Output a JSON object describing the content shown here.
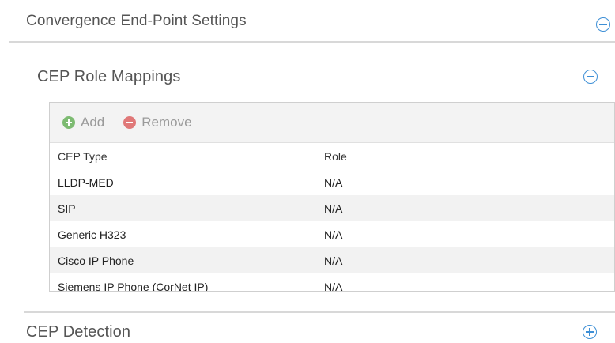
{
  "sections": {
    "convergence": {
      "title": "Convergence End-Point Settings",
      "toggle_icon": "collapse-minus-icon"
    },
    "role_mappings": {
      "title": "CEP Role Mappings",
      "toggle_icon": "collapse-minus-icon"
    },
    "detection": {
      "title": "CEP Detection",
      "toggle_icon": "expand-plus-icon"
    }
  },
  "toolbar": {
    "add_label": "Add",
    "add_icon": "add-circle-icon",
    "remove_label": "Remove",
    "remove_icon": "remove-circle-icon"
  },
  "table": {
    "columns": [
      "CEP Type",
      "Role"
    ],
    "rows": [
      [
        "LLDP-MED",
        "N/A"
      ],
      [
        "SIP",
        "N/A"
      ],
      [
        "Generic H323",
        "N/A"
      ],
      [
        "Cisco IP Phone",
        "N/A"
      ],
      [
        "Siemens IP Phone (CorNet IP)",
        "N/A"
      ]
    ]
  },
  "colors": {
    "accent": "#3d8fd6",
    "add": "#7dbb72",
    "remove": "#e07878",
    "row_alt": "#f2f2f2"
  }
}
